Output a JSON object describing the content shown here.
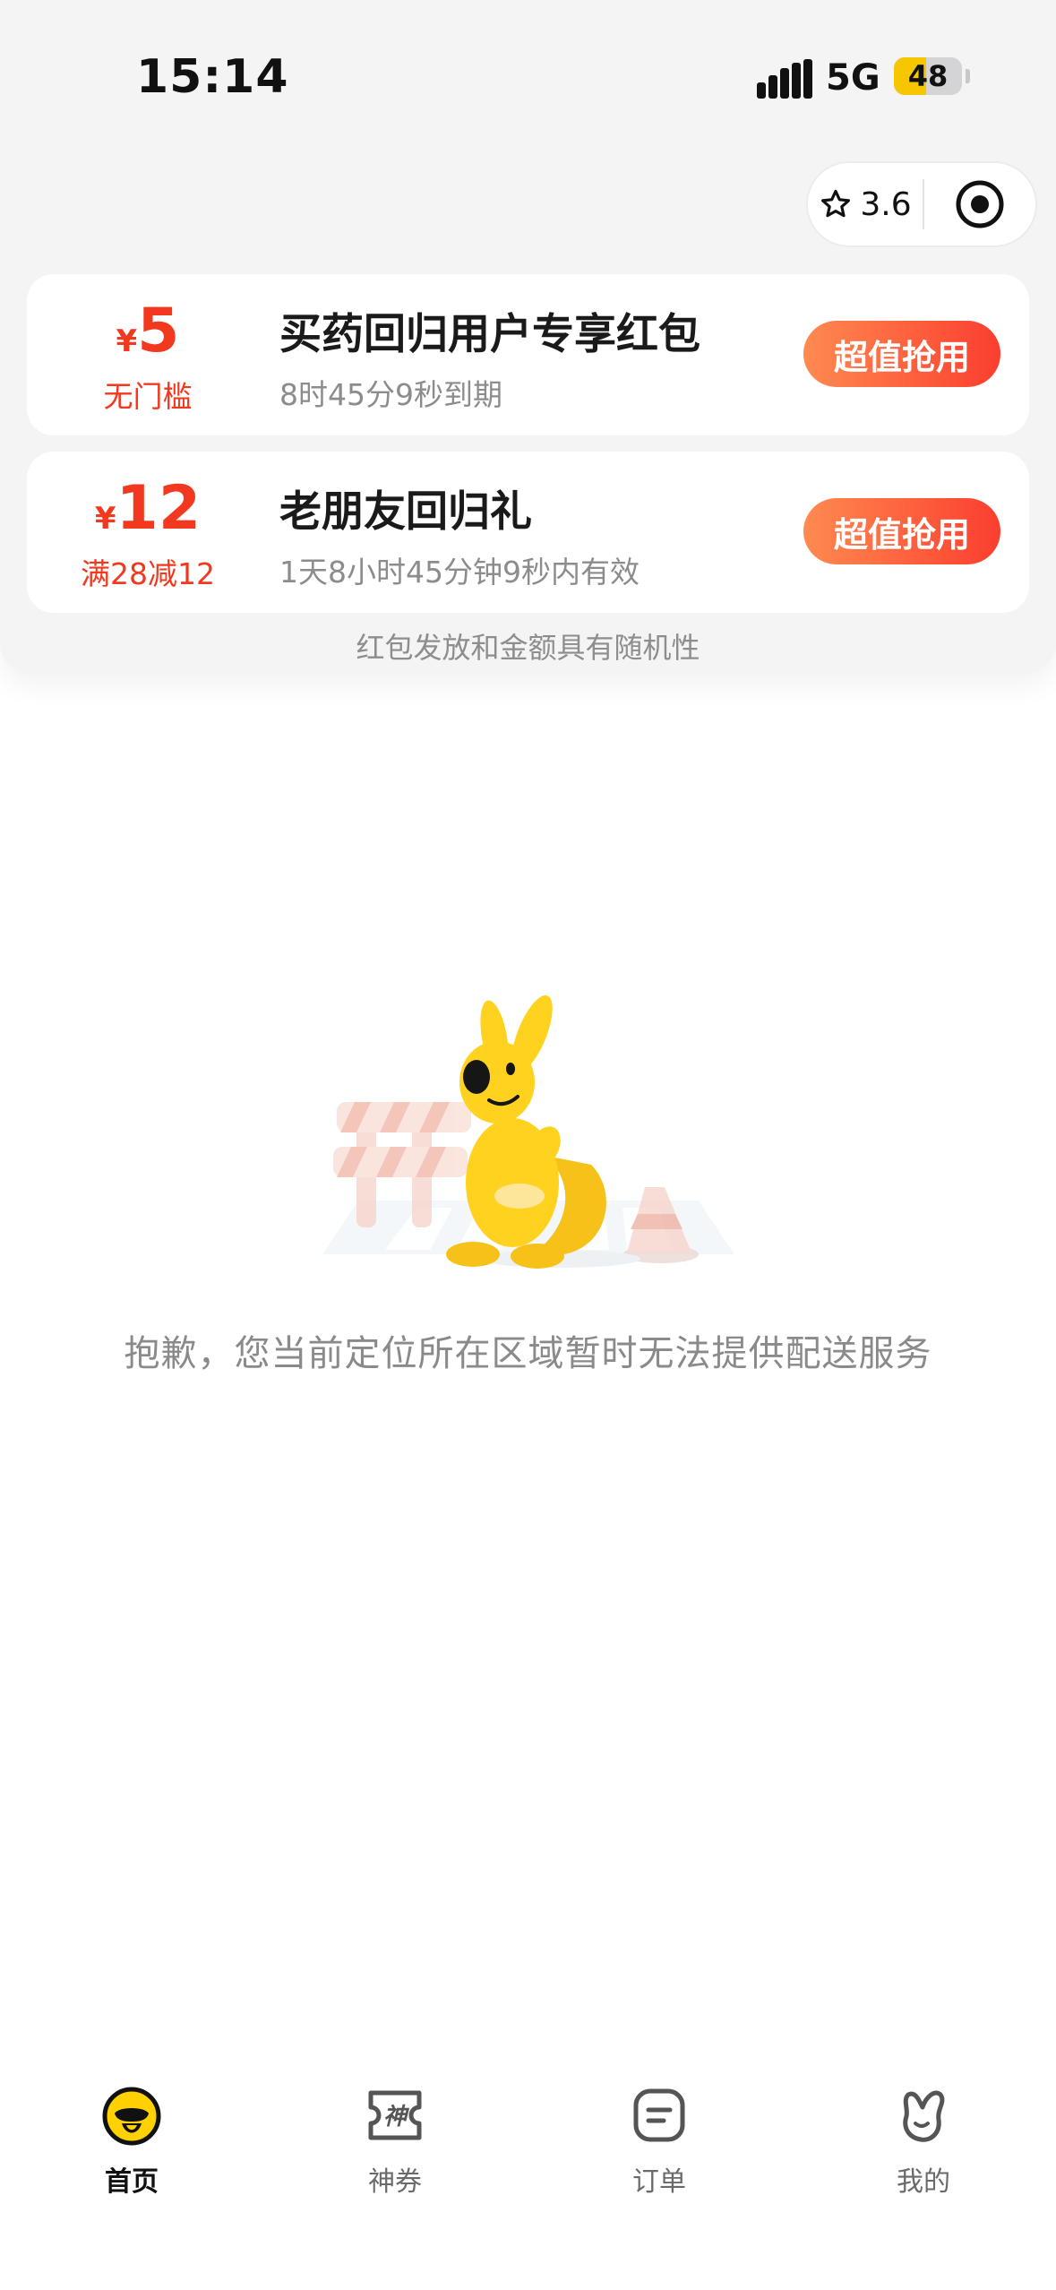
{
  "status_bar": {
    "time": "15:14",
    "network": "5G",
    "battery": "48",
    "battery_level": 0.48
  },
  "capsule": {
    "rating": "3.6"
  },
  "coupons": [
    {
      "currency": "¥",
      "amount": "5",
      "condition": "无门槛",
      "title": "买药回归用户专享红包",
      "subtitle": "8时45分9秒到期",
      "button": "超值抢用"
    },
    {
      "currency": "¥",
      "amount": "12",
      "condition": "满28减12",
      "title": "老朋友回归礼",
      "subtitle": "1天8小时45分钟9秒内有效",
      "button": "超值抢用"
    }
  ],
  "notice": "红包发放和金额具有随机性",
  "empty_state": {
    "message": "抱歉，您当前定位所在区域暂时无法提供配送服务"
  },
  "tabs": [
    {
      "label": "首页",
      "icon": "home-duck-icon",
      "active": true
    },
    {
      "label": "神券",
      "icon": "voucher-icon",
      "active": false
    },
    {
      "label": "订单",
      "icon": "order-icon",
      "active": false
    },
    {
      "label": "我的",
      "icon": "profile-kangaroo-icon",
      "active": false
    }
  ],
  "colors": {
    "accent": "#f2391f",
    "button_gradient_start": "#ff8a50",
    "button_gradient_end": "#fb3e2f",
    "brand_yellow": "#ffd100"
  }
}
